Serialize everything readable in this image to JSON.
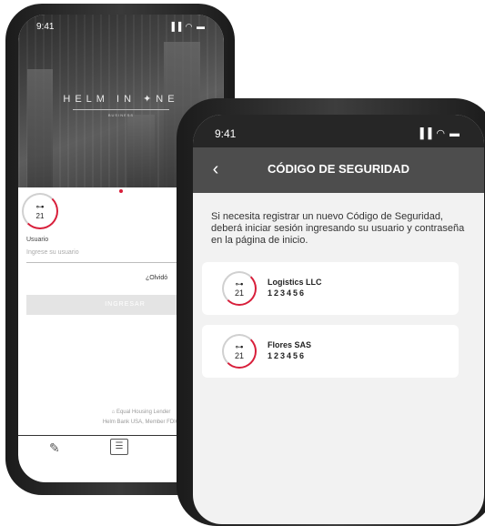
{
  "back_phone": {
    "status_time": "9:41",
    "status_icons": "▐▐ ◠ ▬",
    "brand_name": "HELM IN ✦NE",
    "brand_sub": "BUSINESS",
    "badge_number": "21",
    "login": {
      "user_label": "Usuario",
      "user_placeholder": "Ingrese su usuario",
      "forgot_link": "¿Olvidó",
      "submit_label": "INGRESAR"
    },
    "footer": {
      "equal_housing": "⌂ Equal Housing Lender",
      "member": "Helm Bank USA, Member FDIC"
    },
    "tabbar_icons": [
      "edit-icon",
      "id-card-icon"
    ]
  },
  "front_phone": {
    "status_time": "9:41",
    "status_icons": "▐▐ ◠ ▬",
    "title": "CÓDIGO DE SEGURIDAD",
    "back_glyph": "‹",
    "info_text": "Si necesita registrar un nuevo Código de Seguridad, deberá iniciar sesión ingresando su usuario y contraseña en la página de inicio.",
    "cards": [
      {
        "name": "Logistics LLC",
        "code": "123456",
        "badge": "21"
      },
      {
        "name": "Flores SAS",
        "code": "123456",
        "badge": "21"
      }
    ]
  },
  "colors": {
    "accent": "#d81e3a",
    "header": "#4d4d4d",
    "status_bar": "#262626"
  }
}
